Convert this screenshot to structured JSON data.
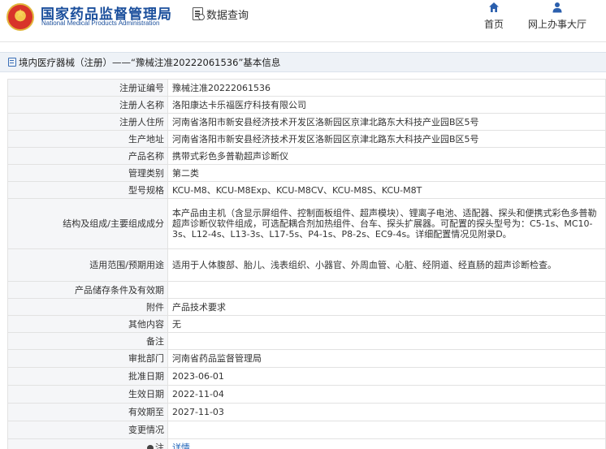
{
  "header": {
    "org_cn": "国家药品监督管理局",
    "org_en": "National Medical Products Administration",
    "data_query": "数据查询",
    "nav": [
      {
        "label": "首页",
        "icon": "home-icon"
      },
      {
        "label": "网上办事大厅",
        "icon": "user-icon"
      }
    ]
  },
  "breadcrumb": {
    "text": "境内医疗器械（注册）——“豫械注准20222061536”基本信息"
  },
  "details": {
    "reg_no_label": "注册证编号",
    "reg_no": "豫械注准20222061536",
    "registrant_label": "注册人名称",
    "registrant": "洛阳康达卡乐福医疗科技有限公司",
    "residence_label": "注册人住所",
    "residence": "河南省洛阳市新安县经济技术开发区洛新园区京津北路东大科技产业园B区5号",
    "production_label": "生产地址",
    "production": "河南省洛阳市新安县经济技术开发区洛新园区京津北路东大科技产业园B区5号",
    "product_label": "产品名称",
    "product": "携带式彩色多普勒超声诊断仪",
    "category_label": "管理类别",
    "category": "第二类",
    "model_label": "型号规格",
    "model": "KCU-M8、KCU-M8Exp、KCU-M8CV、KCU-M8S、KCU-M8T",
    "structure_label": "结构及组成/主要组成成分",
    "structure": "本产品由主机（含显示屏组件、控制面板组件、超声模块）、锂离子电池、适配器、探头和便携式彩色多普勒超声诊断仪软件组成，可选配耦合剂加热组件、台车、探头扩展器。可配置的探头型号为：C5-1s、MC10-3s、L12-4s、L13-3s、L17-5s、P4-1s、P8-2s、EC9-4s。详细配置情况见附录D。",
    "scope_label": "适用范围/预期用途",
    "scope": "适用于人体腹部、胎儿、浅表组织、小器官、外周血管、心脏、经阴道、经直肠的超声诊断检查。",
    "storage_label": "产品储存条件及有效期",
    "storage": "",
    "attachment_label": "附件",
    "attachment": "产品技术要求",
    "other_label": "其他内容",
    "other": "无",
    "remark_label": "备注",
    "remark": "",
    "authority_label": "审批部门",
    "authority": "河南省药品监督管理局",
    "approve_date_label": "批准日期",
    "approve_date": "2023-06-01",
    "effective_date_label": "生效日期",
    "effective_date": "2022-11-04",
    "expiry_label": "有效期至",
    "expiry": "2027-11-03",
    "changes_label": "变更情况",
    "changes": "",
    "note_label": "注",
    "note": "详情"
  }
}
